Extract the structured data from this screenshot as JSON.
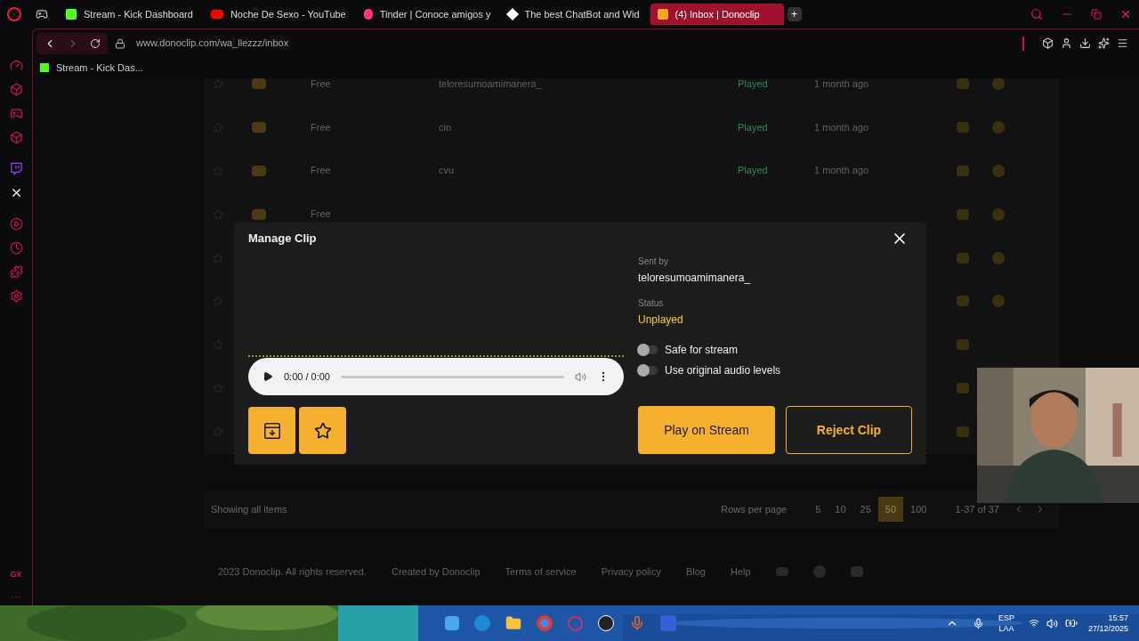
{
  "browser": {
    "tabs": [
      {
        "title": "Stream - Kick Dashboard",
        "kind": "kick",
        "selected": false
      },
      {
        "title": "Noche De Sexo - YouTube",
        "kind": "youtube",
        "selected": false
      },
      {
        "title": "Tinder | Conoce amigos y",
        "kind": "tinder",
        "selected": false
      },
      {
        "title": "The best ChatBot and Wid",
        "kind": "bot",
        "selected": false
      },
      {
        "title": "(4) Inbox | Donoclip",
        "kind": "donoclip",
        "selected": true
      }
    ],
    "new_tab": "+",
    "address": "www.donoclip.com/wa_llezzz/inbox",
    "bookmarks": [
      {
        "label": "Stream - Kick Das..."
      }
    ],
    "sidebar_footer": "GX",
    "sidebar_more": "···"
  },
  "page": {
    "rows": [
      {
        "tier": "Free",
        "name": "teloresumoamimanera_",
        "status": "Played",
        "time": "1 month ago"
      },
      {
        "tier": "Free",
        "name": "cio",
        "status": "Played",
        "time": "1 month ago"
      },
      {
        "tier": "Free",
        "name": "cvu",
        "status": "Played",
        "time": "1 month ago"
      },
      {
        "tier": "Free"
      },
      {},
      {},
      {},
      {},
      {}
    ],
    "showing": "Showing all items",
    "rows_per_page_label": "Rows per page",
    "page_sizes": [
      {
        "label": "5",
        "selected": false
      },
      {
        "label": "10",
        "selected": false
      },
      {
        "label": "25",
        "selected": false
      },
      {
        "label": "50",
        "selected": true
      },
      {
        "label": "100",
        "selected": false
      }
    ],
    "range": "1-37 of 37",
    "footer": [
      "2023 Donoclip. All rights reserved.",
      "Created by Donoclip",
      "Terms of service",
      "Privacy policy",
      "Blog",
      "Help"
    ]
  },
  "modal": {
    "title": "Manage Clip",
    "sent_by_label": "Sent by",
    "sent_by": "teloresumoamimanera_",
    "status_label": "Status",
    "status": "Unplayed",
    "toggles": [
      {
        "label": "Safe for stream",
        "on": false
      },
      {
        "label": "Use original audio levels",
        "on": false
      }
    ],
    "audio": {
      "time": "0:00 / 0:00"
    },
    "play_button": "Play on Stream",
    "reject_button": "Reject Clip"
  },
  "taskbar": {
    "lang": "ESP",
    "region": "LAA",
    "time": "15:57",
    "date": "27/12/2025"
  }
}
